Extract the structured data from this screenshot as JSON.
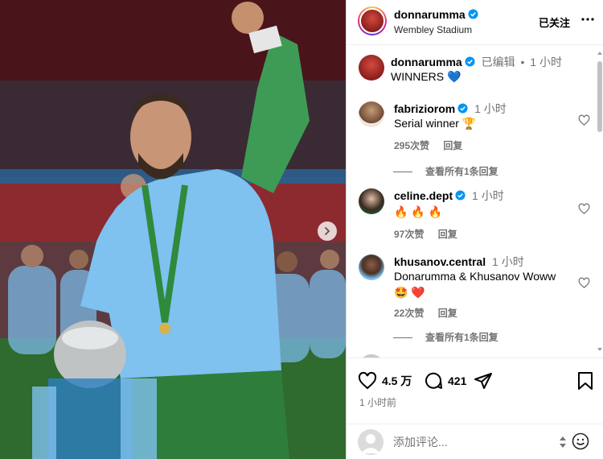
{
  "post": {
    "author": "donnarumma",
    "location": "Wembley Stadium",
    "follow_status": "已关注",
    "more_icon": "more-horizontal-icon",
    "image_alt_icons": [
      "trophy",
      "medal"
    ],
    "next_icon": "chevron-right-icon"
  },
  "caption": {
    "author": "donnarumma",
    "edited": "已编辑",
    "dot": "•",
    "time": "1 小时",
    "text": "WINNERS",
    "emoji": "💙"
  },
  "comments": [
    {
      "user": "fabriziorom",
      "time": "1 小时",
      "text": "Serial winner 🏆",
      "likes": "295次赞",
      "reply": "回复",
      "view_replies": "查看所有1条回复"
    },
    {
      "user": "celine.dept",
      "time": "1 小时",
      "text": "🔥 🔥 🔥",
      "likes": "97次赞",
      "reply": "回复"
    },
    {
      "user": "khusanov.central",
      "time": "1 小时",
      "text": "Donarumma & Khusanov Woww",
      "text2": "🤩 ❤️",
      "likes": "22次赞",
      "reply": "回复",
      "view_replies": "查看所有1条回复"
    }
  ],
  "actions": {
    "likes": "4.5 万",
    "comments": "421",
    "posted": "1 小时前"
  },
  "composer": {
    "placeholder": "添加评论..."
  },
  "colors": {
    "verified": "#0095f6",
    "muted": "#737373",
    "text": "#000000",
    "heart_react": "#ff3040"
  }
}
